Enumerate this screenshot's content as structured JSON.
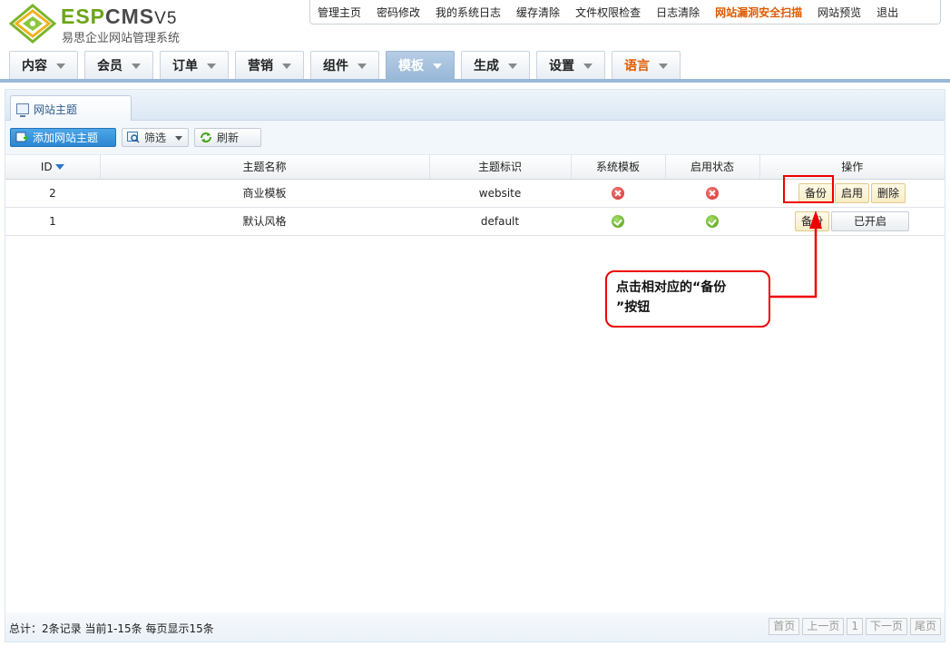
{
  "header": {
    "logo_brand_a": "ESP",
    "logo_brand_b": "CMS",
    "logo_version": "V5",
    "logo_subtitle": "易思企业网站管理系统"
  },
  "topnav": [
    "管理主页",
    "密码修改",
    "我的系统日志",
    "缓存清除",
    "文件权限检查",
    "日志清除",
    "网站漏洞安全扫描",
    "网站预览",
    "退出"
  ],
  "mainnav": [
    "内容",
    "会员",
    "订单",
    "营销",
    "组件",
    "模板",
    "生成",
    "设置",
    "语言"
  ],
  "panel": {
    "tab_label": "网站主题",
    "toolbar": {
      "add_label": "添加网站主题",
      "filter_label": "筛选",
      "refresh_label": "刷新"
    },
    "columns": [
      "ID",
      "主题名称",
      "主题标识",
      "系统模板",
      "启用状态",
      "操作"
    ],
    "rows": [
      {
        "id": "2",
        "name": "商业模板",
        "ident": "website",
        "system": "no",
        "enabled": "no",
        "actions": [
          "备份",
          "启用",
          "删除"
        ]
      },
      {
        "id": "1",
        "name": "默认风格",
        "ident": "default",
        "system": "yes",
        "enabled": "yes",
        "actions": [
          "备份",
          "已开启"
        ]
      }
    ],
    "footer": {
      "summary": "总计：2条记录 当前1-15条 每页显示15条",
      "pager": [
        "首页",
        "上一页",
        "1",
        "下一页",
        "尾页"
      ]
    }
  },
  "annotation": {
    "callout_text": "点击相对应的“备份”按钮",
    "callout_line1": "点击相对应的“备份",
    "callout_line2": "”按钮"
  },
  "colors": {
    "accent": "#98b8d8",
    "alert": "#e05a00",
    "annotation": "#ee0000"
  }
}
